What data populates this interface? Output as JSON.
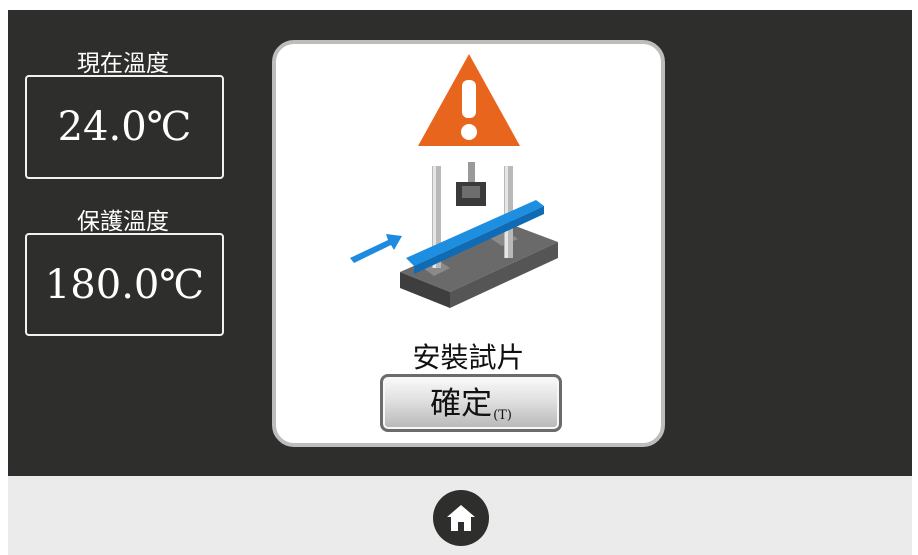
{
  "current_temp": {
    "label": "現在溫度",
    "value": "24.0℃"
  },
  "protect_temp": {
    "label": "保護溫度",
    "value": "180.0℃"
  },
  "dialog": {
    "icon": "warning-icon",
    "illustration": "install-specimen-illustration",
    "message": "安裝試片",
    "confirm_label": "確定",
    "confirm_key": "(T)"
  },
  "footer": {
    "home_icon": "home-icon"
  },
  "colors": {
    "background": "#2e2e2c",
    "footer": "#ebebeb",
    "warning": "#e8651d",
    "specimen": "#1e8ee0"
  }
}
